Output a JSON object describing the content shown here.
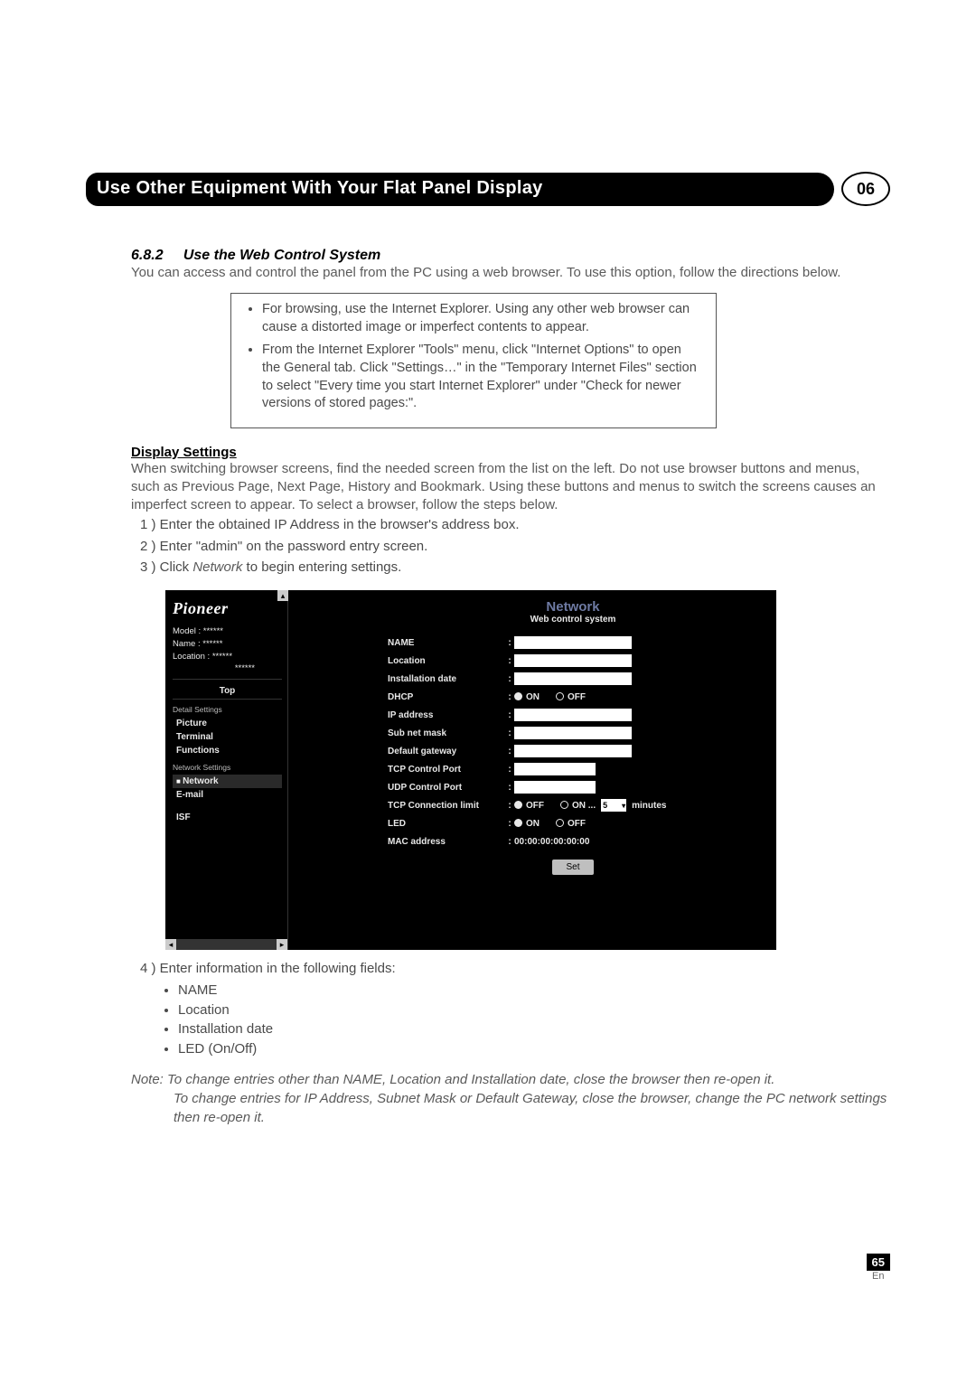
{
  "header": {
    "title": "Use Other Equipment With Your Flat Panel Display",
    "chapter": "06"
  },
  "section": {
    "number": "6.8.2",
    "title": "Use the Web Control System"
  },
  "intro": "You can access and control the panel from the PC using a web browser. To use this option, follow the directions below.",
  "callout": [
    "For browsing, use the Internet Explorer. Using any other web browser can cause a distorted image or imperfect contents to appear.",
    "From the Internet Explorer \"Tools\" menu, click \"Internet Options\" to open the General tab. Click \"Settings…\" in the \"Temporary Internet Files\" section to select  \"Every time you start Internet Explorer\" under \"Check for newer versions of stored pages:\"."
  ],
  "display_settings": {
    "heading": "Display Settings",
    "para": "When switching browser screens, find the needed screen from the list on the left. Do not use browser buttons and menus, such as Previous Page, Next Page, History and Bookmark. Using these buttons and menus to switch the screens causes an imperfect screen to appear. To select a browser, follow the steps below.",
    "steps": {
      "s1": "1 ) Enter the obtained IP Address in the browser's address box.",
      "s2": "2 ) Enter \"admin\" on the password entry screen.",
      "s3_pre": "3 ) Click ",
      "s3_italic": "Network",
      "s3_post": " to begin entering settings."
    }
  },
  "wc": {
    "logo": "Pioneer",
    "info": {
      "model": "Model    : ******",
      "name": "Name    : ******",
      "loc1": "Location : ******",
      "loc2": "******"
    },
    "top": "Top",
    "group1": "Detail Settings",
    "items1": [
      "Picture",
      "Terminal",
      "Functions"
    ],
    "group2": "Network Settings",
    "active": "Network",
    "email": "E-mail",
    "isf": "ISF",
    "title": "Network",
    "subtitle": "Web control system",
    "labels": {
      "name": "NAME",
      "location": "Location",
      "installdate": "Installation date",
      "dhcp": "DHCP",
      "ip": "IP address",
      "subnet": "Sub net mask",
      "gateway": "Default gateway",
      "tcpport": "TCP Control Port",
      "udpport": "UDP Control Port",
      "tcplimit": "TCP Connection limit",
      "led": "LED",
      "mac": "MAC address"
    },
    "opts": {
      "on": "ON",
      "off": "OFF",
      "on_dot": "ON ...",
      "minutes": "minutes"
    },
    "mac_value": "00:00:00:00:00:00",
    "conn_sel": "5",
    "set": "Set"
  },
  "step4": {
    "line": "4 ) Enter information in the following fields:",
    "fields": [
      "NAME",
      "Location",
      "Installation date",
      "LED (On/Off)"
    ]
  },
  "note": {
    "line1": "Note: To change entries other than NAME, Location and Installation date, close the browser then re-open it.",
    "line2": "To change entries for IP Address, Subnet Mask or Default Gateway, close the browser, change the PC network settings then re-open it."
  },
  "footer": {
    "page": "65",
    "lang": "En"
  }
}
